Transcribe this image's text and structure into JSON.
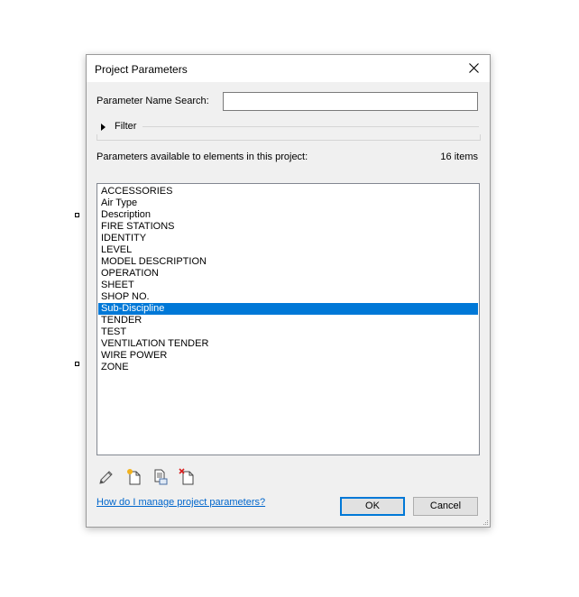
{
  "dialog": {
    "title": "Project Parameters",
    "search_label": "Parameter Name Search:",
    "search_value": "",
    "filter_label": "Filter",
    "available_label": "Parameters available to elements in this project:",
    "count": "16 items",
    "items": [
      {
        "label": "ACCESSORIES",
        "selected": false
      },
      {
        "label": "Air Type",
        "selected": false
      },
      {
        "label": "Description",
        "selected": false
      },
      {
        "label": "FIRE STATIONS",
        "selected": false
      },
      {
        "label": "IDENTITY",
        "selected": false
      },
      {
        "label": "LEVEL",
        "selected": false
      },
      {
        "label": "MODEL DESCRIPTION",
        "selected": false
      },
      {
        "label": "OPERATION",
        "selected": false
      },
      {
        "label": "SHEET",
        "selected": false
      },
      {
        "label": "SHOP NO.",
        "selected": false
      },
      {
        "label": "Sub-Discipline",
        "selected": true
      },
      {
        "label": "TENDER",
        "selected": false
      },
      {
        "label": "TEST",
        "selected": false
      },
      {
        "label": "VENTILATION TENDER",
        "selected": false
      },
      {
        "label": "WIRE POWER",
        "selected": false
      },
      {
        "label": "ZONE",
        "selected": false
      }
    ],
    "tools": [
      "edit-pencil-icon",
      "new-parameter-icon",
      "copy-parameter-icon",
      "delete-parameter-icon"
    ],
    "help_link": "How do I manage project parameters?",
    "ok_label": "OK",
    "cancel_label": "Cancel"
  },
  "colors": {
    "selection": "#0078d7",
    "link": "#0066cc",
    "dialog_bg": "#f0f0f0"
  }
}
